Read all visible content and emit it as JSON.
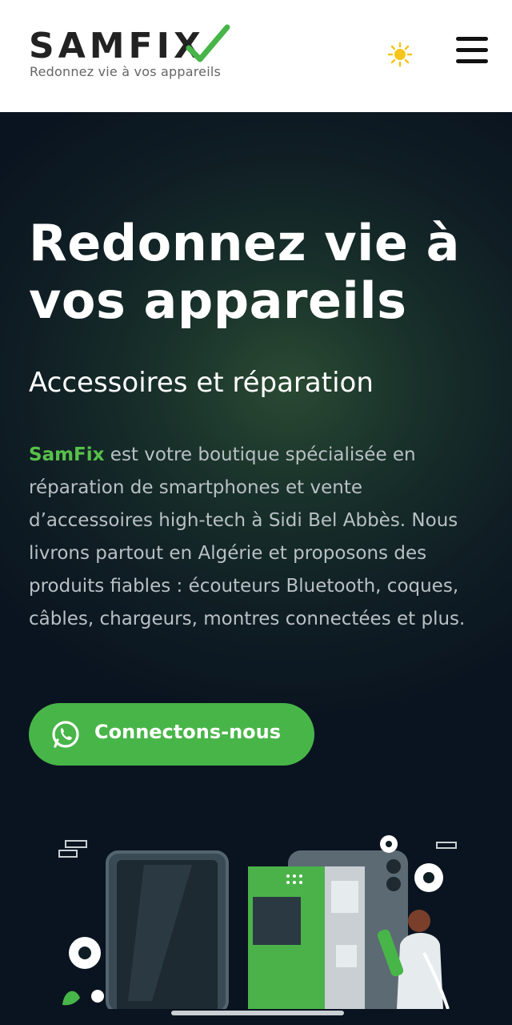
{
  "header": {
    "logo": "SAMFIX",
    "tagline": "Redonnez vie à vos appareils",
    "theme_icon": "sun-icon",
    "menu_icon": "hamburger-menu-icon"
  },
  "hero": {
    "title": "Redonnez vie à vos appareils",
    "subtitle": "Accessoires et réparation",
    "brand_name": "SamFix",
    "description": " est votre boutique spécialisée en réparation de smartphones et vente d’accessoires high-tech à Sidi Bel Abbès. Nous livrons partout en Algérie et proposons des produits fiables : écouteurs Bluetooth, coques, câbles, chargeurs, montres connectées et plus.",
    "cta_label": "Connectons-nous",
    "cta_icon": "whatsapp-icon"
  },
  "colors": {
    "accent": "#48b548",
    "brand_text": "#58c04a",
    "header_bg": "#ffffff",
    "hero_bg": "#0f1d24"
  }
}
